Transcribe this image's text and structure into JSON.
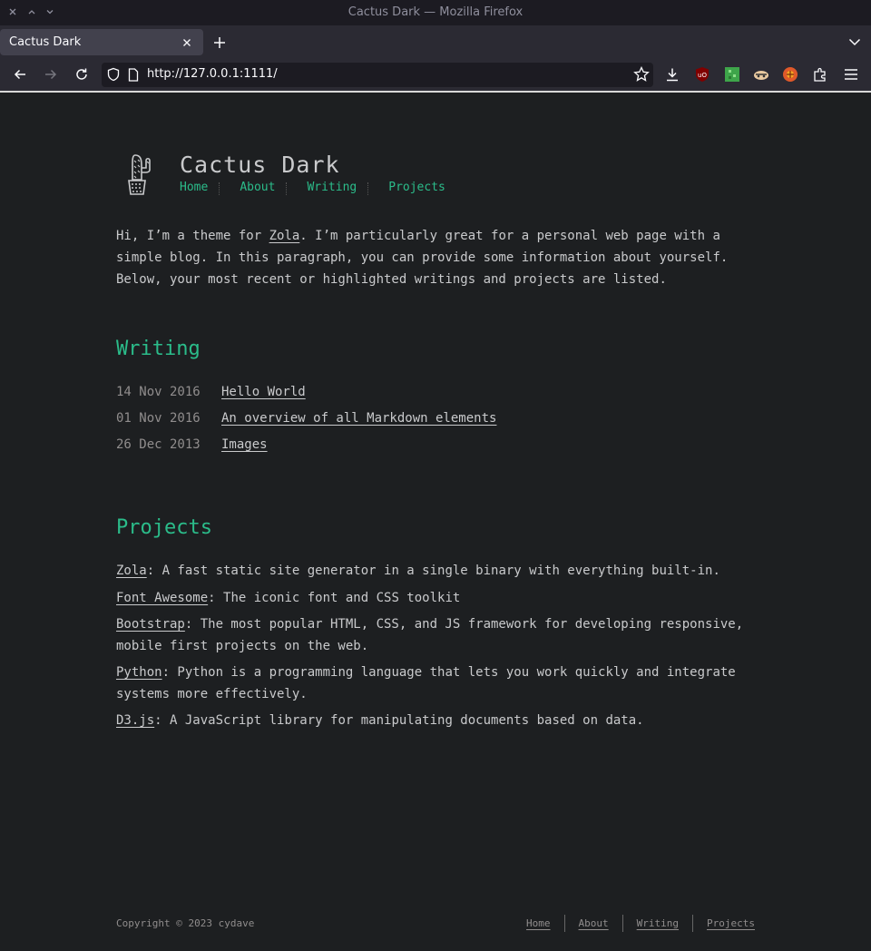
{
  "window": {
    "title": "Cactus Dark — Mozilla Firefox"
  },
  "tab": {
    "title": "Cactus Dark"
  },
  "address_bar": {
    "url": "http://127.0.0.1:1111/"
  },
  "site": {
    "title": "Cactus Dark",
    "nav": [
      "Home",
      "About",
      "Writing",
      "Projects"
    ],
    "intro_before": "Hi, I’m a theme for ",
    "intro_link": "Zola",
    "intro_after": ". I’m particularly great for a personal web page with a simple blog. In this paragraph, you can provide some information about yourself. Below, your most recent or highlighted writings and projects are listed."
  },
  "writing": {
    "heading": "Writing",
    "posts": [
      {
        "date": "14 Nov 2016",
        "title": "Hello World"
      },
      {
        "date": "01 Nov 2016",
        "title": "An overview of all Markdown elements"
      },
      {
        "date": "26 Dec 2013",
        "title": "Images"
      }
    ]
  },
  "projects": {
    "heading": "Projects",
    "items": [
      {
        "name": "Zola",
        "desc": ": A fast static site generator in a single binary with everything built-in."
      },
      {
        "name": "Font Awesome",
        "desc": ": The iconic font and CSS toolkit"
      },
      {
        "name": "Bootstrap",
        "desc": ": The most popular HTML, CSS, and JS framework for developing responsive, mobile first projects on the web."
      },
      {
        "name": "Python",
        "desc": ": Python is a programming language that lets you work quickly and integrate systems more effectively."
      },
      {
        "name": "D3.js",
        "desc": ": A JavaScript library for manipulating documents based on data."
      }
    ]
  },
  "footer": {
    "copyright": "Copyright © 2023 cydave",
    "nav": [
      "Home",
      "About",
      "Writing",
      "Projects"
    ]
  },
  "colors": {
    "accent": "#2bbc8a",
    "background": "#1d1f21",
    "text": "#c9cacc",
    "muted": "#908d8d"
  },
  "icons": [
    "close-icon",
    "minimize-icon",
    "maximize-icon",
    "plus-icon",
    "chevron-down-icon",
    "back-icon",
    "forward-icon",
    "reload-icon",
    "shield-icon",
    "page-icon",
    "star-icon",
    "download-icon",
    "ublock-icon",
    "extension-icon",
    "menu-icon",
    "cactus-logo-icon"
  ]
}
